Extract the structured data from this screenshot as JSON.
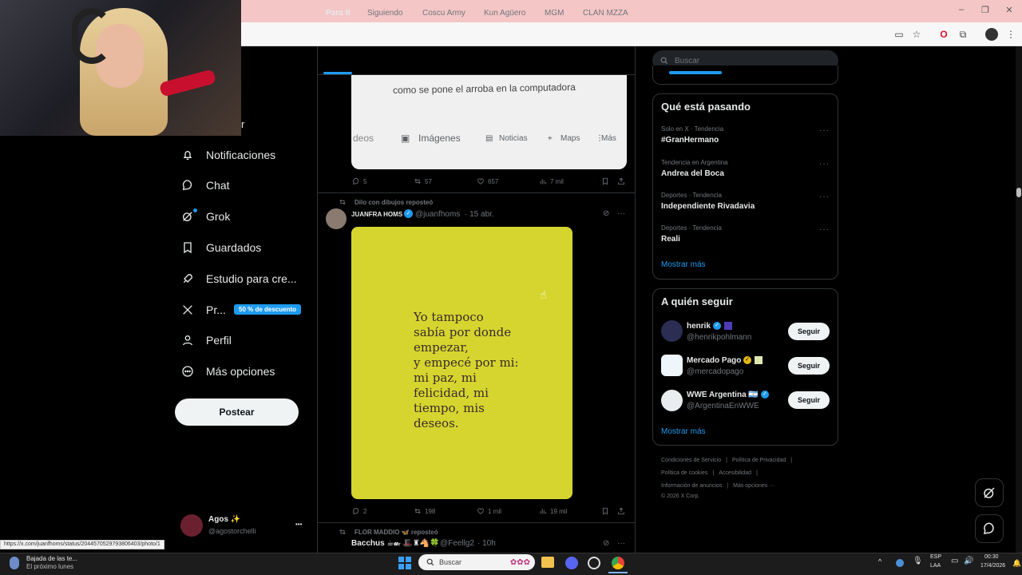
{
  "browser": {
    "window_controls": [
      "–",
      "❐",
      "✕"
    ]
  },
  "feed": {
    "tabs": [
      "Para ti",
      "Siguiendo",
      "Coscu Army",
      "Kun Agüero",
      "MGM",
      "CLAN MZZA"
    ],
    "google_card": {
      "query": "como se pone el arroba en la computadora",
      "tabs": [
        "deos",
        "Imágenes",
        "Noticias",
        "Maps",
        "Más"
      ]
    },
    "post1_actions": {
      "replies": "5",
      "reposts": "57",
      "likes": "657",
      "views": "7 mil"
    },
    "post2": {
      "repost_note": "Dilo con dibujos reposteó",
      "author": "JUANFRA HOMS",
      "handle": "@juanfhoms",
      "date": "· 15 abr.",
      "quote": "Yo tampoco\nsabía por donde\nempezar,\ny empecé por mi:\nmi paz, mi\nfelicidad, mi\ntiempo, mis\ndeseos.",
      "actions": {
        "replies": "2",
        "reposts": "198",
        "likes": "1 mil",
        "views": "19 mil"
      }
    },
    "post3": {
      "repost_note": "FLOR MADDIO 🦋 reposteó",
      "author": "Bacchus ☕𝓊ᵣ 🎩♜🐴🍀",
      "handle": "@Feellg2",
      "date": "· 10h"
    }
  },
  "nav": {
    "partial_label": "r",
    "items": [
      {
        "label": "Notificaciones",
        "icon": "bell-icon"
      },
      {
        "label": "Chat",
        "icon": "chat-icon"
      },
      {
        "label": "Grok",
        "icon": "grok-icon"
      },
      {
        "label": "Guardados",
        "icon": "bookmark-icon"
      },
      {
        "label": "Estudio para cre...",
        "icon": "rocket-icon"
      },
      {
        "label": "Pr...",
        "icon": "x-logo-icon"
      },
      {
        "label": "Perfil",
        "icon": "person-icon"
      },
      {
        "label": "Más opciones",
        "icon": "more-circle-icon"
      }
    ],
    "premium_badge": "50 % de descuento",
    "post_button": "Postear",
    "account": {
      "name": "Agos ✨",
      "handle": "@agostorchelli",
      "menu": "•••"
    }
  },
  "right": {
    "search_placeholder": "Buscar",
    "trends_title": "Qué está pasando",
    "trends": [
      {
        "meta": "Solo en X · Tendencia",
        "name": "#GranHermano"
      },
      {
        "meta": "Tendencia en Argentina",
        "name": "Andrea del Boca"
      },
      {
        "meta": "Deportes · Tendencia",
        "name": "Independiente Rivadavia"
      },
      {
        "meta": "Deportes · Tendencia",
        "name": "Reali"
      }
    ],
    "trends_more": "Mostrar más",
    "follow_title": "A quién seguir",
    "follow": [
      {
        "name": "henrik",
        "handle": "@henrikpohlmann",
        "button": "Seguir"
      },
      {
        "name": "Mercado Pago",
        "handle": "@mercadopago",
        "button": "Seguir"
      },
      {
        "name": "WWE Argentina 🇦🇷",
        "handle": "@ArgentinaEnWWE",
        "button": "Seguir"
      }
    ],
    "follow_more": "Mostrar más",
    "footer": {
      "row1": [
        "Condiciones de Servicio",
        "|",
        "Política de Privacidad",
        "|"
      ],
      "row2": [
        "Política de cookies",
        "|",
        "Accesibilidad",
        "|"
      ],
      "row3": [
        "Información de anuncios",
        "|",
        "Más opciones ···"
      ],
      "copyright": "© 2026 X Corp."
    }
  },
  "taskbar": {
    "status_url": "https://x.com/juanfhoms/status/2044570529793806403/photo/1",
    "notif_title": "Bajada de las te...",
    "notif_sub": "El próximo lunes",
    "search": "Buscar",
    "lang1": "ESP",
    "lang2": "LAA",
    "time": "00:30",
    "date": "17/4/2026"
  },
  "colors": {
    "accent": "#1d9bf0",
    "card_yellow": "#d6d52f",
    "chrome_pink": "#f4c6c6"
  }
}
